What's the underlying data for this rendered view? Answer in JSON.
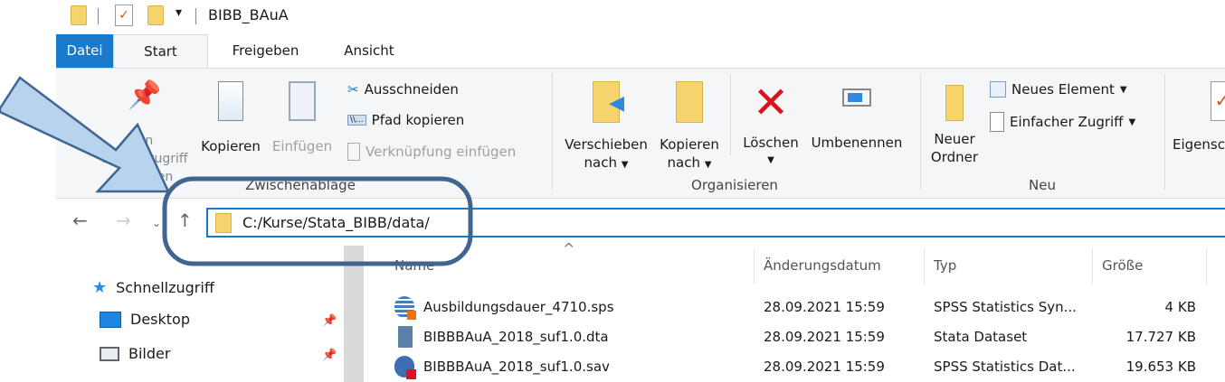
{
  "window": {
    "title": "BIBB_BAuA"
  },
  "tabs": [
    "Datei",
    "Start",
    "Freigeben",
    "Ansicht"
  ],
  "ribbon": {
    "clipboard": {
      "pin": "An Schnellzugriff anheften",
      "copy": "Kopieren",
      "paste": "Einfügen",
      "cut": "Ausschneiden",
      "copy_path": "Pfad kopieren",
      "paste_shortcut": "Verknüpfung einfügen",
      "group": "Zwischenablage"
    },
    "organize": {
      "move_1": "Verschieben",
      "move_2": "nach",
      "copyto_1": "Kopieren",
      "copyto_2": "nach",
      "delete": "Löschen",
      "rename": "Umbenennen",
      "group": "Organisieren"
    },
    "new": {
      "folder_1": "Neuer",
      "folder_2": "Ordner",
      "new_item": "Neues Element",
      "easy_access": "Einfacher Zugriff",
      "group": "Neu"
    },
    "open": {
      "properties": "Eigenschaften"
    }
  },
  "address": {
    "path": "C:/Kurse/Stata_BIBB/data/"
  },
  "sidebar": {
    "items": [
      {
        "label": "Schnellzugriff"
      },
      {
        "label": "Desktop"
      },
      {
        "label": "Bilder"
      }
    ]
  },
  "columns": [
    "Name",
    "Änderungsdatum",
    "Typ",
    "Größe"
  ],
  "files": [
    {
      "name": "Ausbildungsdauer_4710.sps",
      "date": "28.09.2021 15:59",
      "type": "SPSS Statistics Syn...",
      "size": "4 KB"
    },
    {
      "name": "BIBBBAuA_2018_suf1.0.dta",
      "date": "28.09.2021 15:59",
      "type": "Stata Dataset",
      "size": "17.727 KB"
    },
    {
      "name": "BIBBBAuA_2018_suf1.0.sav",
      "date": "28.09.2021 15:59",
      "type": "SPSS Statistics Dat...",
      "size": "19.653 KB"
    }
  ],
  "colors": {
    "accent": "#1979ca",
    "annotation_stroke": "#3f6590",
    "annotation_fill": "#b8d3ee"
  }
}
